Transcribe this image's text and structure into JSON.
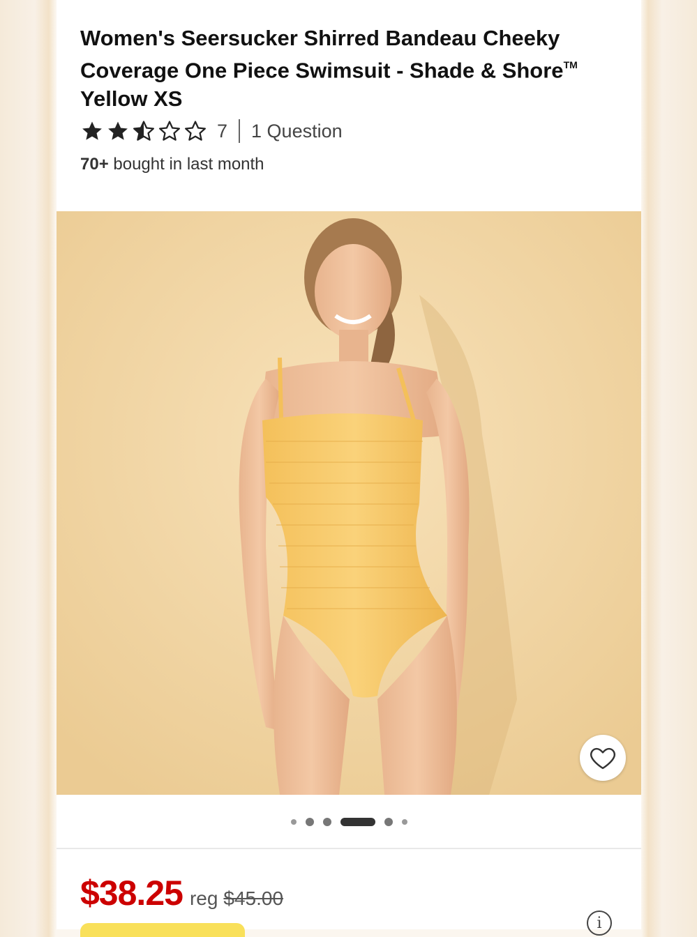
{
  "product": {
    "title": "Women's Seersucker Shirred Bandeau Cheeky Coverage One Piece Swimsuit - Shade & Shore",
    "trademark": "TM",
    "variant": "Yellow XS",
    "rating_value": 2.5,
    "rating_max": 5,
    "review_count": "7",
    "questions_link": "1 Question",
    "bought_count": "70+",
    "bought_text": "bought in last month"
  },
  "gallery": {
    "image_alt": "Model wearing yellow seersucker one piece swimsuit",
    "total_images": 6,
    "active_index": 3,
    "favorite_icon": "heart-outline-icon"
  },
  "pricing": {
    "current_price": "$38.25",
    "reg_label": "reg",
    "original_price": "$45.00",
    "info_icon": "info-icon",
    "info_glyph": "i"
  },
  "colors": {
    "price_red": "#cc0000",
    "star_fill": "#222222",
    "promo_yellow": "#f9e05a",
    "swimsuit_yellow": "#f6c65a"
  }
}
